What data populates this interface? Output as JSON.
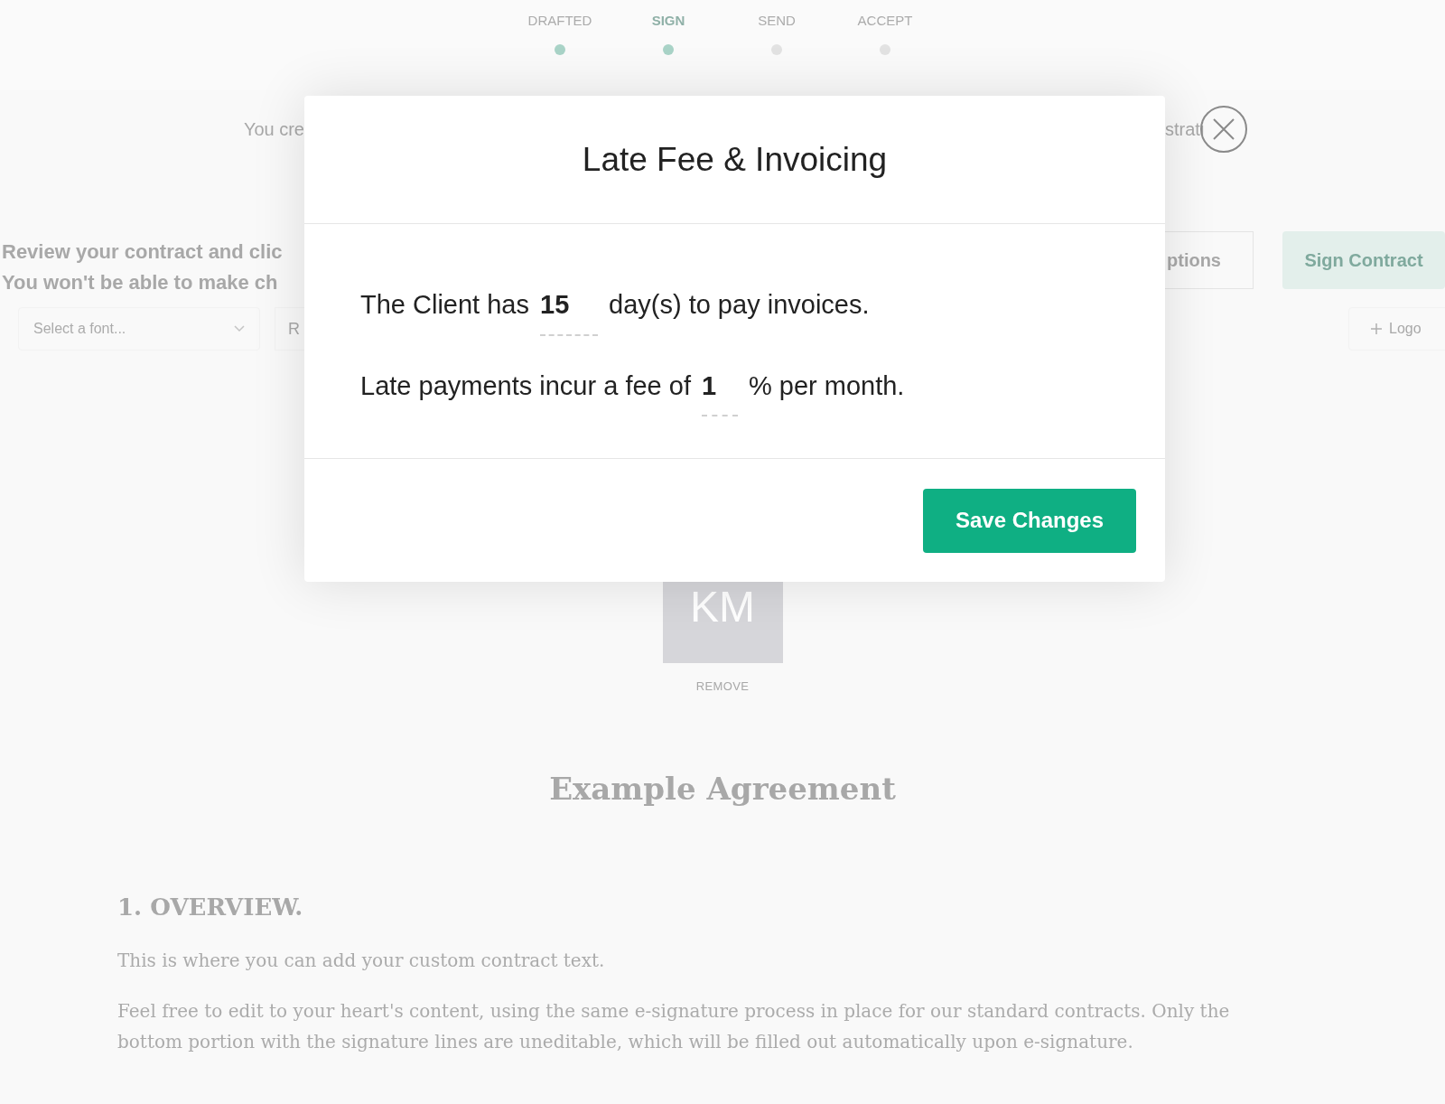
{
  "steps": [
    {
      "label": "DRAFTED",
      "completed": true,
      "selected": false
    },
    {
      "label": "SIGN",
      "completed": true,
      "selected": true
    },
    {
      "label": "SEND",
      "completed": false,
      "selected": false
    },
    {
      "label": "ACCEPT",
      "completed": false,
      "selected": false
    }
  ],
  "intro": {
    "left": "You cre",
    "right": "strati"
  },
  "instructions": [
    "Review your contract and clic",
    "You won't be able to make ch"
  ],
  "options_button": "ptions",
  "sign_button": "Sign Contract",
  "font_select": {
    "placeholder": "Select a font..."
  },
  "partial_button": "R",
  "logo_button": "Logo",
  "logo": {
    "initials": "KM",
    "remove": "REMOVE"
  },
  "document": {
    "title": "Example Agreement",
    "sections": [
      {
        "heading": "1. OVERVIEW.",
        "paragraphs": [
          "This is where you can add your custom contract text.",
          "Feel free to edit to your heart's content, using the same e-signature process in place for our standard contracts. Only the bottom portion with the signature lines are uneditable, which will be filled out automatically upon e-signature."
        ]
      }
    ]
  },
  "modal": {
    "title": "Late Fee & Invoicing",
    "lines": [
      {
        "before": "The Client has",
        "value": "15",
        "after": "day(s) to pay invoices."
      },
      {
        "before": "Late payments incur a fee of",
        "value": "1",
        "after": "% per month."
      }
    ],
    "save_button": "Save Changes"
  }
}
